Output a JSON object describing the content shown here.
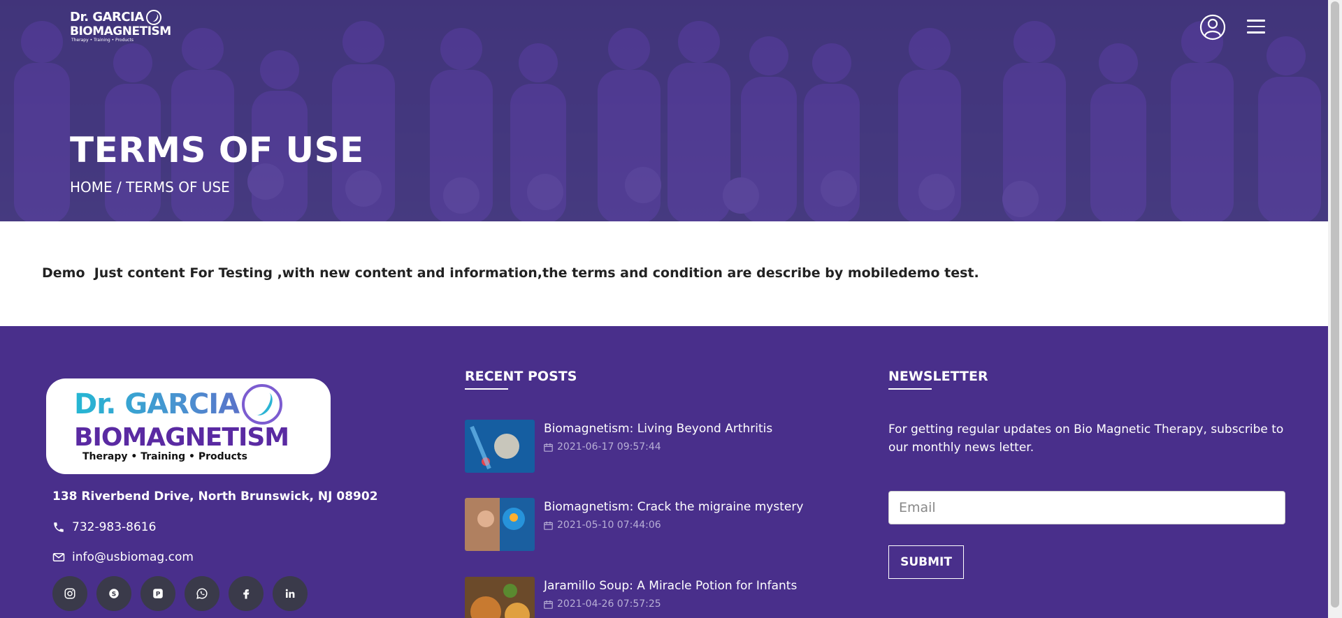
{
  "header": {
    "logo": {
      "line1": "Dr. GARCIA",
      "line2": "BIOMAGNETISM",
      "line3": "Therapy • Training • Products"
    },
    "user_icon": "user-circle-icon",
    "menu_icon": "hamburger-menu-icon",
    "title": "TERMS OF USE",
    "breadcrumb": {
      "home": "HOME",
      "separator": " / ",
      "current": "TERMS OF USE"
    }
  },
  "content": {
    "text": "Demo  Just content For Testing ,with new content and information,the terms and condition are describe by mobiledemo test."
  },
  "footer": {
    "logo": {
      "line1": "Dr. GARCIA",
      "line2": "BIOMAGNETISM",
      "line3": "Therapy • Training • Products"
    },
    "address": "138 Riverbend Drive, North Brunswick, NJ 08902",
    "phone": "732-983-8616",
    "email": "info@usbiomag.com",
    "socials": [
      "instagram-icon",
      "skype-icon",
      "pinterest-icon",
      "whatsapp-icon",
      "facebook-icon",
      "linkedin-icon"
    ],
    "recent_posts": {
      "heading": "RECENT POSTS",
      "items": [
        {
          "title": "Biomagnetism: Living Beyond Arthritis",
          "date": "2021-06-17 09:57:44"
        },
        {
          "title": "Biomagnetism: Crack the migraine mystery",
          "date": "2021-05-10 07:44:06"
        },
        {
          "title": "Jaramillo Soup: A Miracle Potion for Infants",
          "date": "2021-04-26 07:57:25"
        }
      ]
    },
    "newsletter": {
      "heading": "NEWSLETTER",
      "description": "For getting regular updates on Bio Magnetic Therapy, subscribe to our monthly news letter.",
      "email_placeholder": "Email",
      "submit_label": "SUBMIT"
    }
  },
  "colors": {
    "footer_bg": "#492f8b",
    "hero_overlay": "#462d96",
    "social_bg": "#3a3a4a"
  }
}
